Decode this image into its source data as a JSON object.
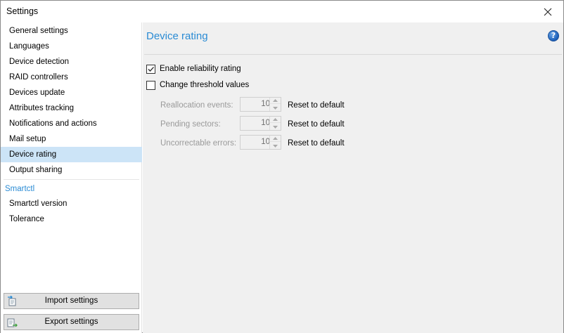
{
  "window": {
    "title": "Settings"
  },
  "sidebar": {
    "items": [
      {
        "label": "General settings",
        "selected": false
      },
      {
        "label": "Languages",
        "selected": false
      },
      {
        "label": "Device detection",
        "selected": false
      },
      {
        "label": "RAID controllers",
        "selected": false
      },
      {
        "label": "Devices update",
        "selected": false
      },
      {
        "label": "Attributes tracking",
        "selected": false
      },
      {
        "label": "Notifications and actions",
        "selected": false
      },
      {
        "label": "Mail setup",
        "selected": false
      },
      {
        "label": "Device rating",
        "selected": true
      },
      {
        "label": "Output sharing",
        "selected": false
      }
    ],
    "group_label": "Smartctl",
    "group_items": [
      {
        "label": "Smartctl version"
      },
      {
        "label": "Tolerance"
      }
    ],
    "import_label": "Import settings",
    "export_label": "Export settings"
  },
  "content": {
    "heading": "Device rating",
    "help_glyph": "?",
    "enable_reliability": {
      "label": "Enable reliability rating",
      "checked": true
    },
    "change_threshold": {
      "label": "Change threshold values",
      "checked": false
    },
    "fields": [
      {
        "label": "Reallocation events:",
        "value": "10",
        "reset": "Reset to default"
      },
      {
        "label": "Pending sectors:",
        "value": "10",
        "reset": "Reset to default"
      },
      {
        "label": "Uncorrectable errors:",
        "value": "10",
        "reset": "Reset to default"
      }
    ]
  },
  "colors": {
    "accent": "#2a8bd4",
    "selection": "#cce4f7",
    "panel": "#f0f0f0",
    "disabled_text": "#9a9a9a"
  }
}
